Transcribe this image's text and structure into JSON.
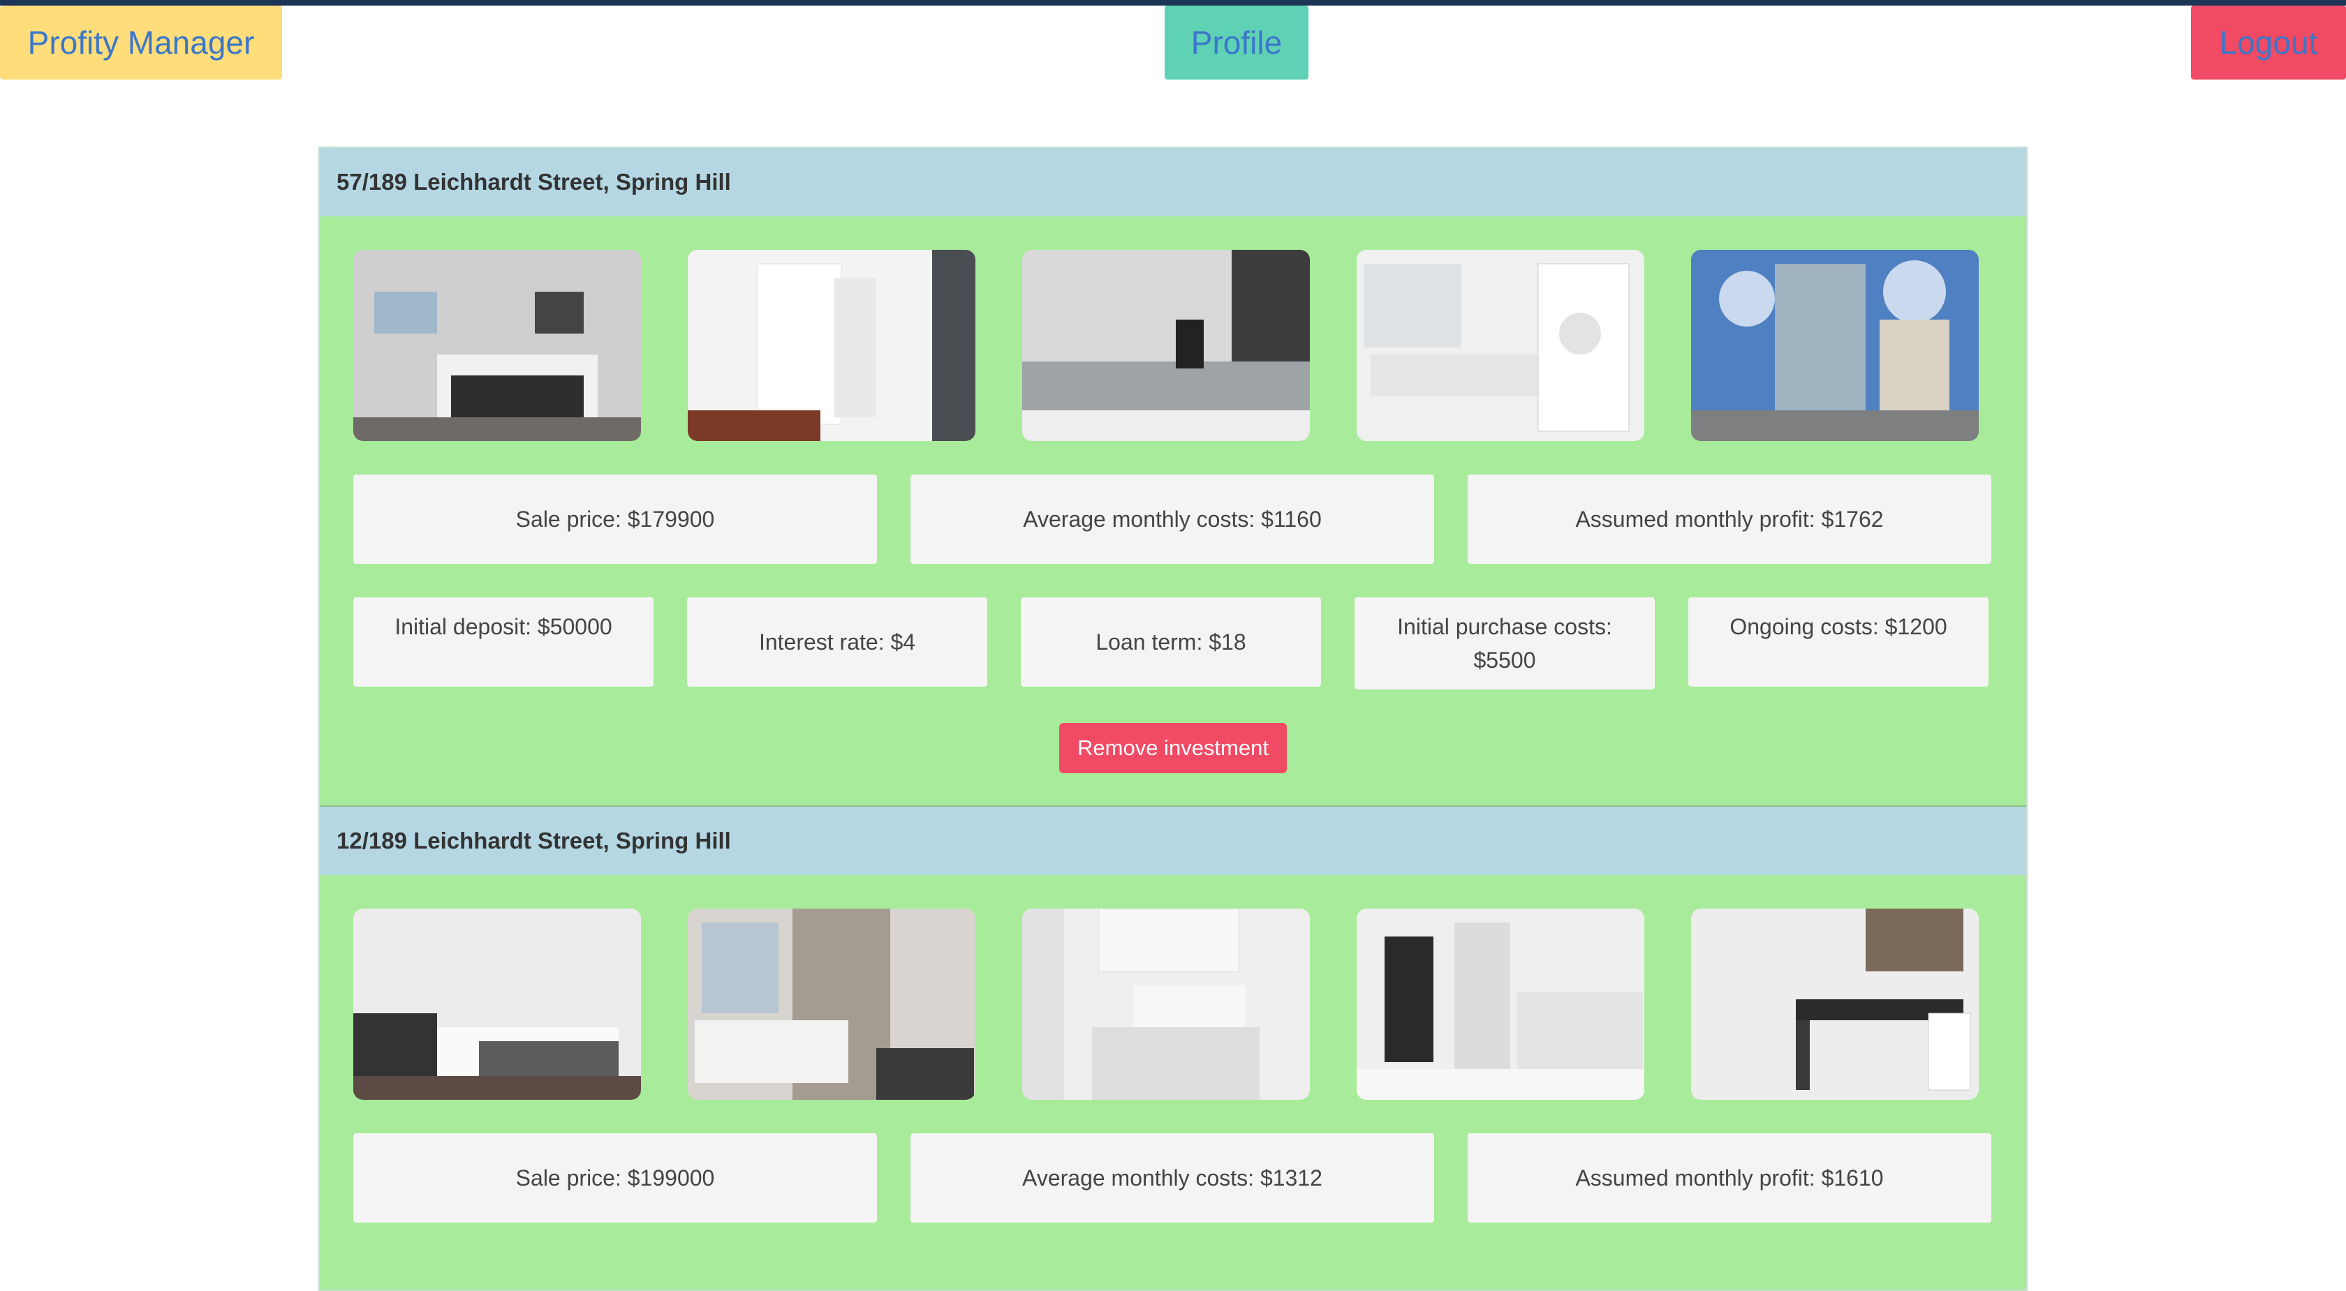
{
  "nav": {
    "brand": "Profity Manager",
    "profile": "Profile",
    "logout": "Logout"
  },
  "investments": [
    {
      "address": "57/189 Leichhardt Street, Spring Hill",
      "summary": {
        "sale_price": "Sale price: $179900",
        "avg_monthly_costs": "Average monthly costs: $1160",
        "assumed_monthly_profit": "Assumed monthly profit: $1762"
      },
      "details": {
        "initial_deposit": "Initial deposit: $50000",
        "interest_rate": "Interest rate: $4",
        "loan_term": "Loan term: $18",
        "initial_purchase_costs": "Initial purchase costs: $5500",
        "ongoing_costs": "Ongoing costs: $1200"
      },
      "remove_label": "Remove investment"
    },
    {
      "address": "12/189 Leichhardt Street, Spring Hill",
      "summary": {
        "sale_price": "Sale price: $199000",
        "avg_monthly_costs": "Average monthly costs: $1312",
        "assumed_monthly_profit": "Assumed monthly profit: $1610"
      }
    }
  ],
  "colors": {
    "brand": "#ffdd7a",
    "profile": "#5fd1b5",
    "logout": "#f04a65",
    "card_bg": "#a8eb9a",
    "header_bg": "#b4d7e3"
  }
}
